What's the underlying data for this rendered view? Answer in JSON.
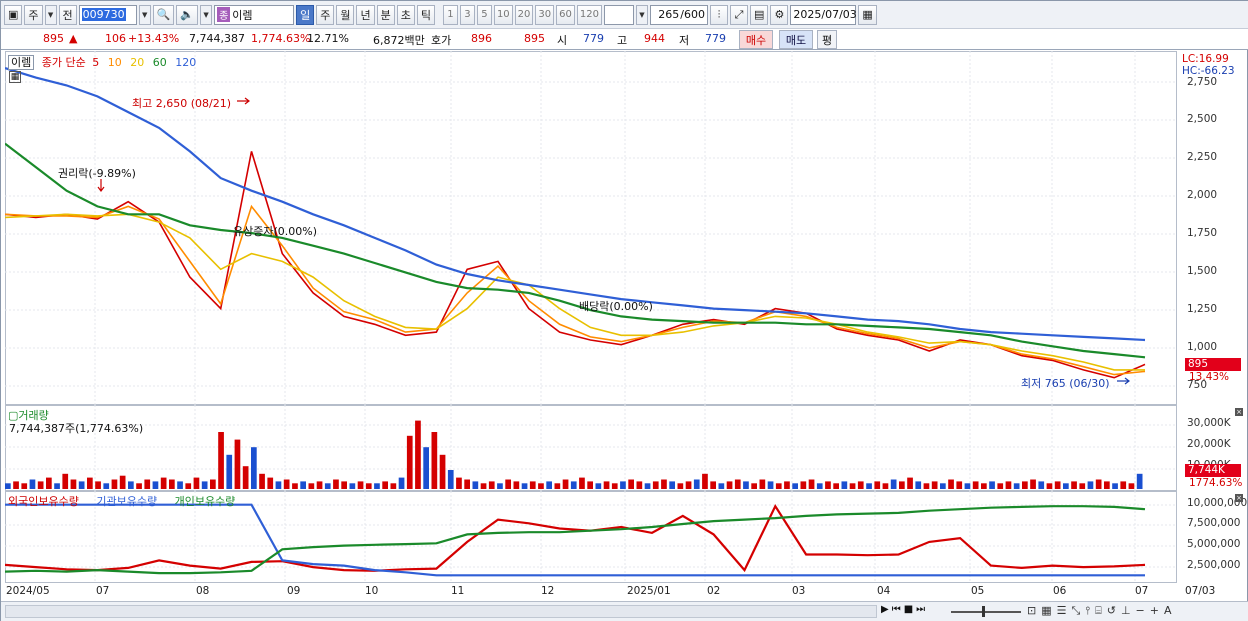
{
  "toolbar": {
    "market": "주",
    "prev_btn": "전",
    "code": "009730",
    "name_tag": "종",
    "stock_name": "이렘",
    "periods": [
      "일",
      "주",
      "월",
      "년",
      "분",
      "초",
      "틱"
    ],
    "intervals": [
      "1",
      "3",
      "5",
      "10",
      "20",
      "30",
      "60",
      "120"
    ],
    "count": "265",
    "count_total": "/600",
    "date": "2025/07/03"
  },
  "quote": {
    "price": "895",
    "change": "106",
    "change_pct": "+13.43%",
    "volume": "7,744,387",
    "vol_pct": "1,774.63%",
    "turnover": "12.71%",
    "amount": "6,872백만",
    "hoga_label": "호가",
    "ask": "896",
    "bid": "895",
    "open_label": "시",
    "open": "779",
    "high_label": "고",
    "high": "944",
    "low_label": "저",
    "low": "779",
    "buy_btn": "매수",
    "sell_btn": "매도",
    "eval_btn": "평"
  },
  "price_pane": {
    "stock_label": "이렘",
    "ma_title": "종가 단순",
    "ma_periods": [
      "5",
      "10",
      "20",
      "60",
      "120"
    ],
    "ma_colors": [
      "#d40000",
      "#ff8c00",
      "#e8c000",
      "#1a8a2a",
      "#2f5fd6"
    ],
    "lc_label": "LC:16.99",
    "hc_label": "HC:-66.23",
    "y_ticks": [
      "2,750",
      "2,500",
      "2,250",
      "2,000",
      "1,750",
      "1,500",
      "1,250",
      "1,000",
      "750"
    ],
    "price_flag": "895",
    "pct_flag": "13.43%",
    "ann_high": "최고 2,650 (08/21)",
    "ann_rights": "권리락(-9.89%)",
    "ann_capinc": "유상증자(0.00%)",
    "ann_div": "배당락(0.00%)",
    "ann_low": "최저 765 (06/30)"
  },
  "vol_pane": {
    "title": "거래량",
    "value": "7,744,387주(1,774.63%)",
    "y_ticks": [
      "30,000K",
      "20,000K",
      "10,000K"
    ],
    "flag1": "7,744K",
    "flag2": "1774.63%"
  },
  "hold_pane": {
    "legend": [
      "외국인보유수량",
      "기관보유수량",
      "개인보유수량"
    ],
    "y_ticks": [
      "10,000,000",
      "7,500,000",
      "5,000,000",
      "2,500,000"
    ]
  },
  "x_axis": [
    "2024/05",
    "07",
    "08",
    "09",
    "10",
    "11",
    "12",
    "2025/01",
    "02",
    "03",
    "04",
    "05",
    "06",
    "07",
    "07/03"
  ],
  "chart_data": {
    "type": "line",
    "series": [
      {
        "name": "5",
        "values": [
          1850,
          1830,
          1850,
          1820,
          1930,
          1800,
          1450,
          1250,
          2250,
          1600,
          1350,
          1200,
          1150,
          1080,
          1100,
          1500,
          1550,
          1250,
          1100,
          1050,
          1020,
          1080,
          1150,
          1180,
          1150,
          1250,
          1220,
          1120,
          1080,
          1050,
          980,
          1050,
          1020,
          950,
          920,
          860,
          810,
          895
        ]
      },
      {
        "name": "10",
        "values": [
          1850,
          1840,
          1840,
          1830,
          1900,
          1820,
          1550,
          1280,
          1900,
          1650,
          1380,
          1230,
          1180,
          1100,
          1120,
          1350,
          1520,
          1300,
          1150,
          1070,
          1040,
          1080,
          1130,
          1170,
          1160,
          1230,
          1200,
          1130,
          1090,
          1060,
          1000,
          1040,
          1020,
          960,
          930,
          880,
          830,
          850
        ]
      },
      {
        "name": "20",
        "values": [
          1830,
          1840,
          1850,
          1840,
          1850,
          1800,
          1700,
          1500,
          1600,
          1550,
          1450,
          1300,
          1200,
          1130,
          1120,
          1250,
          1450,
          1400,
          1250,
          1130,
          1080,
          1080,
          1100,
          1140,
          1160,
          1200,
          1190,
          1150,
          1100,
          1070,
          1030,
          1040,
          1020,
          980,
          950,
          910,
          860,
          860
        ]
      },
      {
        "name": "60",
        "values": [
          2300,
          2150,
          2000,
          1900,
          1850,
          1850,
          1780,
          1750,
          1730,
          1700,
          1650,
          1600,
          1540,
          1480,
          1420,
          1380,
          1370,
          1350,
          1300,
          1240,
          1200,
          1180,
          1170,
          1160,
          1160,
          1160,
          1150,
          1150,
          1140,
          1130,
          1120,
          1100,
          1080,
          1040,
          1010,
          980,
          960,
          940
        ]
      },
      {
        "name": "120",
        "values": [
          2780,
          2720,
          2670,
          2600,
          2500,
          2400,
          2250,
          2080,
          2000,
          1930,
          1850,
          1780,
          1700,
          1620,
          1530,
          1470,
          1430,
          1400,
          1370,
          1340,
          1310,
          1290,
          1270,
          1250,
          1240,
          1230,
          1220,
          1200,
          1180,
          1170,
          1150,
          1120,
          1100,
          1090,
          1080,
          1070,
          1060,
          1050
        ]
      }
    ],
    "ylim": [
      700,
      2800
    ]
  },
  "hold_data": {
    "ylim": [
      0,
      10500000
    ],
    "series": [
      {
        "name": "외국인보유수량",
        "values": [
          1900000,
          1600000,
          1300000,
          1200000,
          1500000,
          2500000,
          1800000,
          1400000,
          2300000,
          2400000,
          1600000,
          1200000,
          1100000,
          1300000,
          1400000,
          5000000,
          8000000,
          7500000,
          6800000,
          6500000,
          7000000,
          6200000,
          8500000,
          6000000,
          1200000,
          9800000,
          3300000,
          3300000,
          3200000,
          3300000,
          5000000,
          5500000,
          1800000,
          1500000,
          1800000,
          1600000,
          1700000,
          1900000
        ]
      },
      {
        "name": "기관보유수량",
        "values": [
          10000000,
          10000000,
          10000000,
          10000000,
          10000000,
          10000000,
          10000000,
          10000000,
          10000000,
          2500000,
          2000000,
          1800000,
          1200000,
          900000,
          500000,
          500000,
          500000,
          500000,
          500000,
          500000,
          500000,
          500000,
          500000,
          500000,
          500000,
          500000,
          500000,
          500000,
          500000,
          500000,
          500000,
          500000,
          500000,
          500000,
          500000,
          500000,
          500000,
          500000
        ]
      },
      {
        "name": "개인보유수량",
        "values": [
          1000000,
          1100000,
          1000000,
          1200000,
          1000000,
          800000,
          800000,
          900000,
          1100000,
          4000000,
          4300000,
          4500000,
          4600000,
          4700000,
          4800000,
          6000000,
          6200000,
          6300000,
          6300000,
          6500000,
          6700000,
          7000000,
          7400000,
          7800000,
          8000000,
          8200000,
          8500000,
          8700000,
          8800000,
          8900000,
          9200000,
          9400000,
          9600000,
          9700000,
          9800000,
          9800000,
          9700000,
          9400000
        ]
      }
    ]
  }
}
